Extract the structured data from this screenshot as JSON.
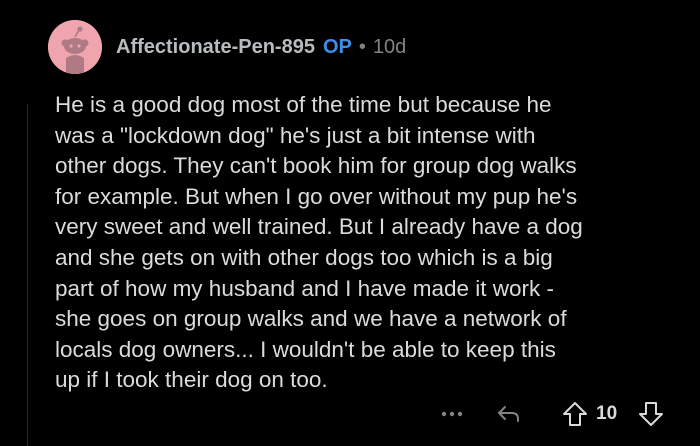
{
  "comment": {
    "author": "Affectionate-Pen-895",
    "op_badge": "OP",
    "separator": "•",
    "age": "10d",
    "avatar_icon": "reddit-snoo-avatar-icon",
    "avatar_color": "#f0a4ae",
    "op_color": "#3d8ee6",
    "body": "He is a good dog most of the time but because he\nwas a \"lockdown dog\" he's just a bit intense with\nother dogs. They can't book him for group dog walks\nfor example. But when I go over without my pup he's\nvery sweet and well trained. But I already have a dog\nand she gets on with other dogs too which is a big\npart of how my husband and I have made it work -\nshe goes on group walks and we have a network of\nlocals dog owners... I wouldn't be able to keep this\nup if I took their dog on too.",
    "actions": {
      "more_icon": "more-options-icon",
      "reply_icon": "reply-icon",
      "upvote_icon": "upvote-arrow-icon",
      "score": "10",
      "downvote_icon": "downvote-arrow-icon"
    }
  }
}
